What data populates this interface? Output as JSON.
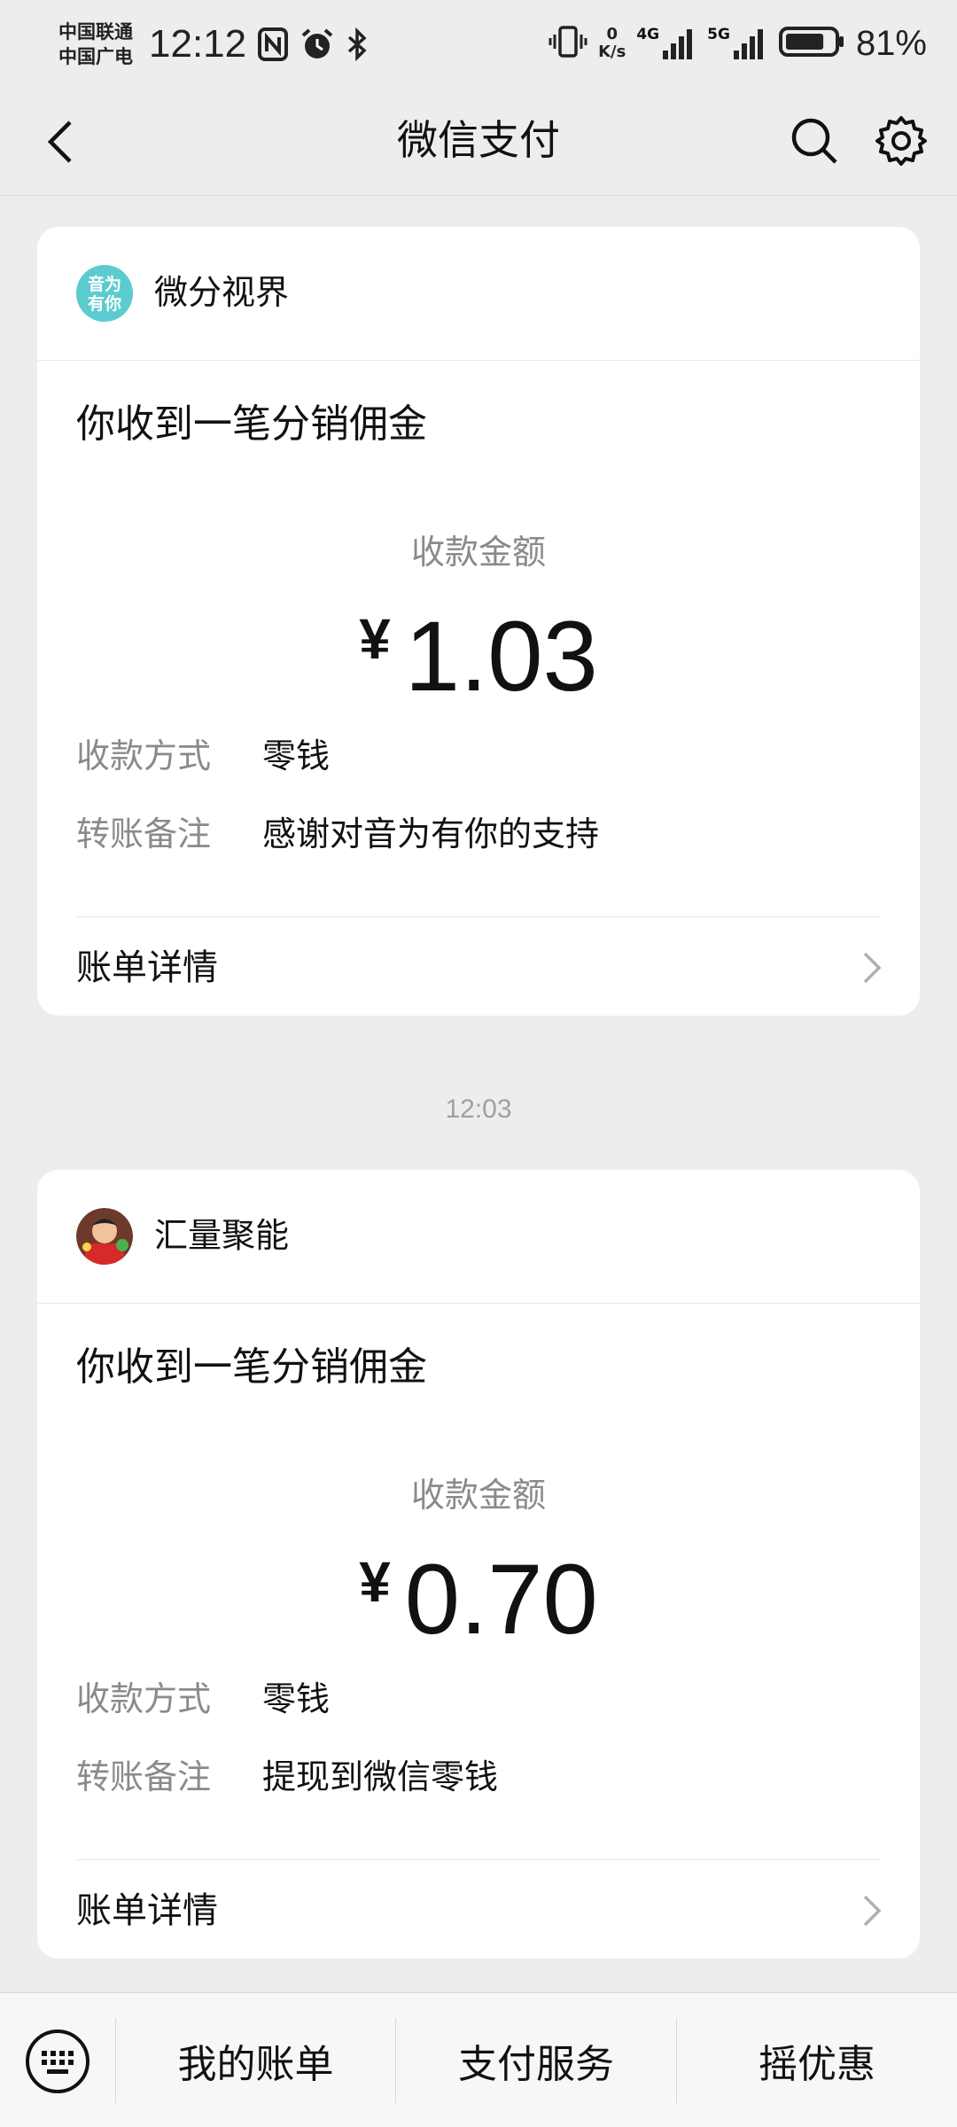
{
  "status_bar": {
    "carrier_1": "中国联通",
    "carrier_2": "中国广电",
    "time": "12:12",
    "net_speed_value": "0",
    "net_speed_unit": "K/s",
    "net_4g": "4G",
    "net_5g": "5G",
    "battery_percent": "81%",
    "battery_level": 0.81
  },
  "header": {
    "title": "微信支付"
  },
  "cards": [
    {
      "source_name": "微分视界",
      "avatar_text": "音为有你",
      "headline": "你收到一笔分销佣金",
      "amount_label": "收款金额",
      "currency": "¥",
      "amount": "1.03",
      "rows": [
        {
          "key": "收款方式",
          "value": "零钱"
        },
        {
          "key": "转账备注",
          "value": "感谢对音为有你的支持"
        }
      ],
      "detail_label": "账单详情"
    },
    {
      "source_name": "汇量聚能",
      "headline": "你收到一笔分销佣金",
      "amount_label": "收款金额",
      "currency": "¥",
      "amount": "0.70",
      "rows": [
        {
          "key": "收款方式",
          "value": "零钱"
        },
        {
          "key": "转账备注",
          "value": "提现到微信零钱"
        }
      ],
      "detail_label": "账单详情"
    }
  ],
  "timestamp": "12:03",
  "bottom_bar": {
    "items": [
      "我的账单",
      "支付服务",
      "摇优惠"
    ]
  },
  "colors": {
    "background": "#ededed",
    "card": "#ffffff",
    "secondary_text": "#8a8a8a"
  }
}
